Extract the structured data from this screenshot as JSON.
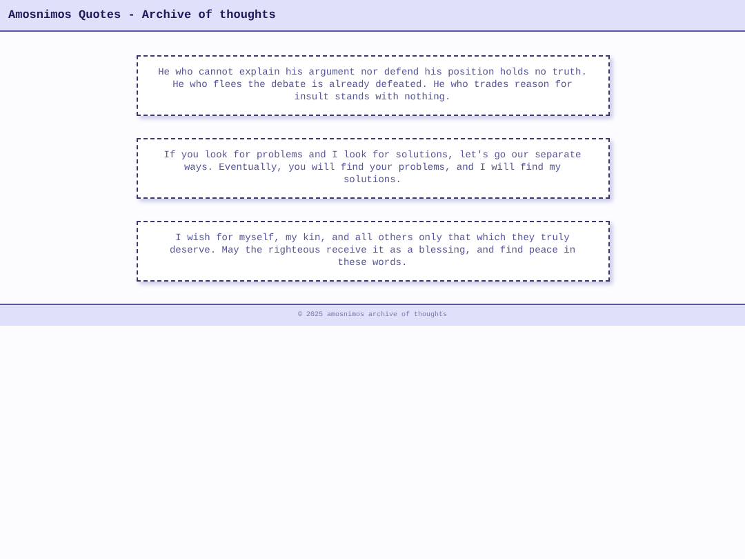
{
  "header": {
    "title": "Amosnimos Quotes - Archive of thoughts"
  },
  "quotes": [
    {
      "text": "He who cannot explain his argument nor defend his position holds no truth. He who flees the debate is already defeated. He who trades reason for insult stands with nothing."
    },
    {
      "text": "If you look for problems and I look for solutions, let's go our separate ways. Eventually, you will find your problems, and I will find my solutions."
    },
    {
      "text": "I wish for myself, my kin, and all others only that which they truly deserve. May the righteous receive it as a blessing, and find peace in these words."
    }
  ],
  "footer": {
    "text": "© 2025 amosnimos archive of thoughts"
  }
}
